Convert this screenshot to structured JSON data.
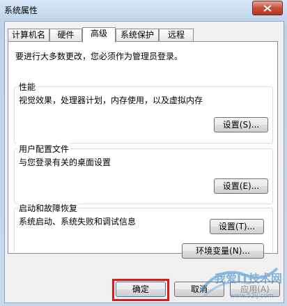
{
  "window": {
    "title": "系统属性"
  },
  "tabs": [
    {
      "label": "计算机名"
    },
    {
      "label": "硬件"
    },
    {
      "label": "高级"
    },
    {
      "label": "系统保护"
    },
    {
      "label": "远程"
    }
  ],
  "active_tab": "高级",
  "intro": "要进行大多数更改，您必须作为管理员登录。",
  "groups": [
    {
      "title": "性能",
      "description": "视觉效果，处理器计划，内存使用，以及虚拟内存",
      "button": "设置(S)..."
    },
    {
      "title": "用户配置文件",
      "description": "与您登录有关的桌面设置",
      "button": "设置(E)..."
    },
    {
      "title": "启动和故障恢复",
      "description": "系统启动、系统失败和调试信息",
      "button": "设置(T)..."
    }
  ],
  "env_button": "环境变量(N)...",
  "footer": {
    "ok": "确定",
    "cancel": "取消",
    "apply": "应用(A)"
  },
  "watermark": {
    "text": "我爱IT技术网",
    "url": "www.52ij.com"
  },
  "colors": {
    "highlight": "#d81c1c",
    "close": "#c7503c"
  }
}
